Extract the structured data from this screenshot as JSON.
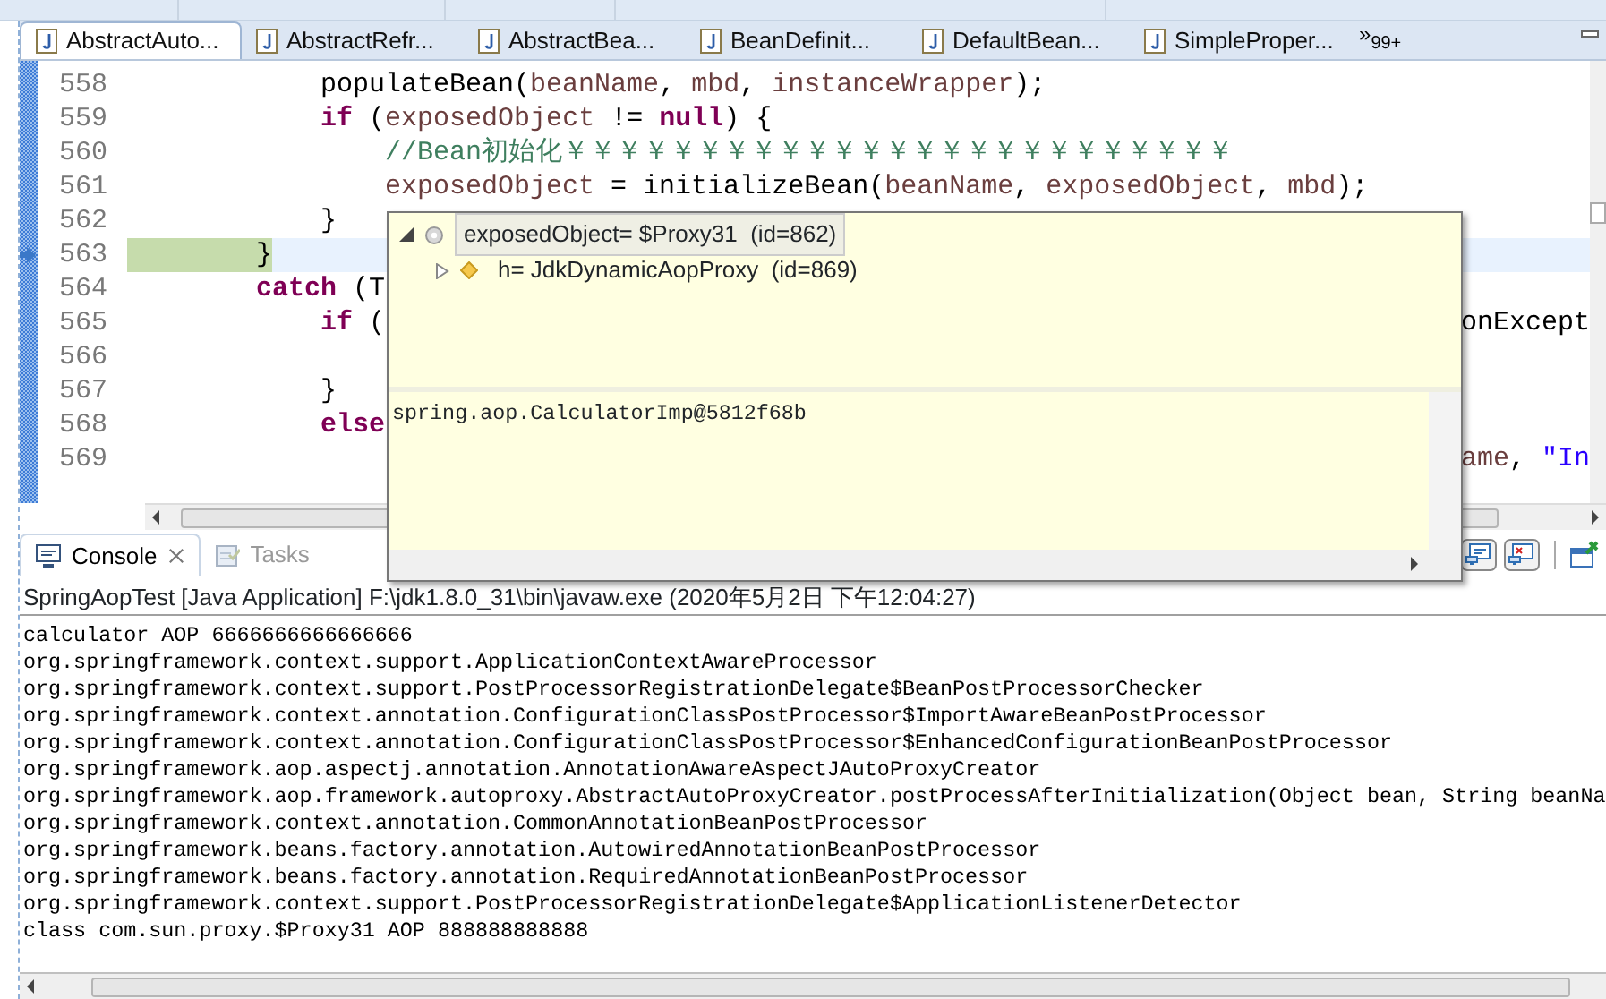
{
  "editor": {
    "tabs": [
      {
        "label": "AbstractAuto...",
        "selected": true
      },
      {
        "label": "AbstractRefr...",
        "selected": false
      },
      {
        "label": "AbstractBea...",
        "selected": false
      },
      {
        "label": "BeanDefinit...",
        "selected": false
      },
      {
        "label": "DefaultBean...",
        "selected": false
      },
      {
        "label": "SimpleProper...",
        "selected": false
      }
    ],
    "overflow": "»",
    "overflow_count": "99+",
    "lines": [
      {
        "number": "558",
        "current": false,
        "left": [
          {
            "text": "            populateBean(",
            "kind": "plain"
          },
          {
            "text": "beanName",
            "kind": "variable"
          },
          {
            "text": ", ",
            "kind": "plain"
          },
          {
            "text": "mbd",
            "kind": "variable"
          },
          {
            "text": ", ",
            "kind": "plain"
          },
          {
            "text": "instanceWrapper",
            "kind": "variable"
          },
          {
            "text": ");",
            "kind": "plain"
          }
        ]
      },
      {
        "number": "559",
        "current": false,
        "left": [
          {
            "text": "            if",
            "kind": "keyword"
          },
          {
            "text": " (",
            "kind": "plain"
          },
          {
            "text": "exposedObject",
            "kind": "variable"
          },
          {
            "text": " != ",
            "kind": "plain"
          },
          {
            "text": "null",
            "kind": "keyword"
          },
          {
            "text": ") {",
            "kind": "plain"
          }
        ]
      },
      {
        "number": "560",
        "current": false,
        "left": [
          {
            "text": "                //Bean初始化￥￥￥￥￥￥￥￥￥￥￥￥￥￥￥￥￥￥￥￥￥￥￥￥￥",
            "kind": "comment"
          }
        ]
      },
      {
        "number": "561",
        "current": false,
        "left": [
          {
            "text": "                exposedObject",
            "kind": "variable"
          },
          {
            "text": " = initializeBean(",
            "kind": "plain"
          },
          {
            "text": "beanName",
            "kind": "variable"
          },
          {
            "text": ", ",
            "kind": "plain"
          },
          {
            "text": "exposedObject",
            "kind": "variable"
          },
          {
            "text": ", ",
            "kind": "plain"
          },
          {
            "text": "mbd",
            "kind": "variable"
          },
          {
            "text": ");",
            "kind": "plain"
          }
        ]
      },
      {
        "number": "562",
        "current": false,
        "left": [
          {
            "text": "            }",
            "kind": "plain"
          }
        ]
      },
      {
        "number": "563",
        "current": true,
        "left": [
          {
            "text": "        }",
            "kind": "plain"
          }
        ]
      },
      {
        "number": "564",
        "current": false,
        "left": [
          {
            "text": "        catch",
            "kind": "keyword"
          },
          {
            "text": " (T",
            "kind": "plain"
          }
        ]
      },
      {
        "number": "565",
        "current": false,
        "left": [
          {
            "text": "            if",
            "kind": "keyword"
          },
          {
            "text": " (",
            "kind": "plain"
          }
        ],
        "right": [
          {
            "text": "onExcept",
            "kind": "plain"
          }
        ]
      },
      {
        "number": "566",
        "current": false
      },
      {
        "number": "567",
        "current": false,
        "left": [
          {
            "text": "            }",
            "kind": "plain"
          }
        ]
      },
      {
        "number": "568",
        "current": false,
        "left": [
          {
            "text": "            else",
            "kind": "keyword"
          }
        ]
      },
      {
        "number": "569",
        "current": false,
        "right": [
          {
            "text": "ame",
            "kind": "variable"
          },
          {
            "text": ", ",
            "kind": "plain"
          },
          {
            "text": "\"In",
            "kind": "string"
          }
        ]
      }
    ]
  },
  "popup": {
    "tree": [
      {
        "label": "exposedObject= $Proxy31  (id=862)",
        "kind": "local",
        "expanded": true,
        "selected": true,
        "children": [
          {
            "label": "h= JdkDynamicAopProxy  (id=869)",
            "kind": "field",
            "expanded": false,
            "selected": false
          }
        ]
      }
    ],
    "detail": "spring.aop.CalculatorImp@5812f68b"
  },
  "console": {
    "tabs": [
      {
        "label": "Console",
        "selected": true
      },
      {
        "label": "Tasks",
        "selected": false
      }
    ],
    "header": "SpringAopTest [Java Application] F:\\jdk1.8.0_31\\bin\\javaw.exe (2020年5月2日 下午12:04:27)",
    "lines": [
      "calculator AOP 6666666666666666",
      "org.springframework.context.support.ApplicationContextAwareProcessor",
      "org.springframework.context.support.PostProcessorRegistrationDelegate$BeanPostProcessorChecker",
      "org.springframework.context.annotation.ConfigurationClassPostProcessor$ImportAwareBeanPostProcessor",
      "org.springframework.context.annotation.ConfigurationClassPostProcessor$EnhancedConfigurationBeanPostProcessor",
      "org.springframework.aop.aspectj.annotation.AnnotationAwareAspectJAutoProxyCreator",
      "org.springframework.aop.framework.autoproxy.AbstractAutoProxyCreator.postProcessAfterInitialization(Object bean, String beanNa",
      "org.springframework.context.annotation.CommonAnnotationBeanPostProcessor",
      "org.springframework.beans.factory.annotation.AutowiredAnnotationBeanPostProcessor",
      "org.springframework.beans.factory.annotation.RequiredAnnotationBeanPostProcessor",
      "org.springframework.context.support.PostProcessorRegistrationDelegate$ApplicationListenerDetector",
      "class com.sun.proxy.$Proxy31 AOP 888888888888"
    ]
  }
}
